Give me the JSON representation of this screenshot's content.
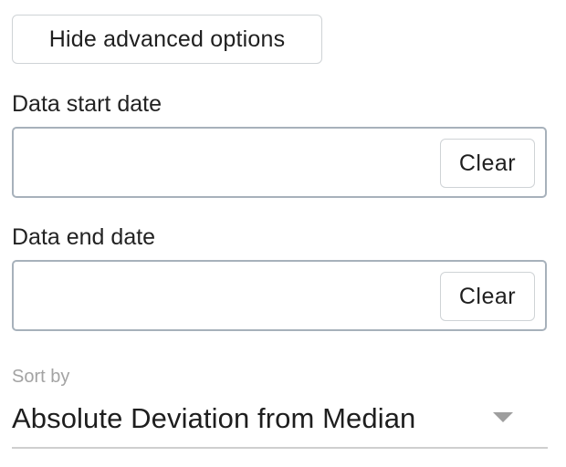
{
  "advanced_toggle": {
    "label": "Hide advanced options"
  },
  "start_date": {
    "label": "Data start date",
    "value": "",
    "clear_label": "Clear"
  },
  "end_date": {
    "label": "Data end date",
    "value": "",
    "clear_label": "Clear"
  },
  "sort": {
    "label": "Sort by",
    "selected": "Absolute Deviation from Median",
    "icon": "dropdown-caret-icon"
  },
  "colors": {
    "input_border": "#a7b1bb",
    "button_border": "#cfd3d6",
    "muted_label": "#a3a3a3",
    "caret": "#9e9e9e"
  }
}
